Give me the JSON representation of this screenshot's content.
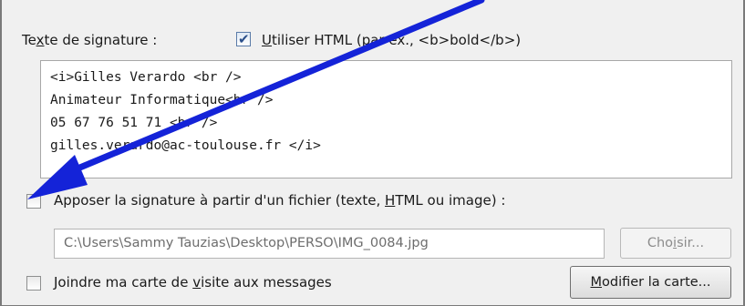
{
  "signature_label_prefix": "Te",
  "signature_label_accel": "x",
  "signature_label_suffix": "te de signature :",
  "use_html": {
    "checked": true,
    "label_accel": "U",
    "label_rest": "tiliser HTML (par ex., <b>bold</b>)"
  },
  "signature_text": "<i>Gilles Verardo <br />\nAnimateur Informatique<br />\n05 67 76 51 71 <br />\ngilles.verardo@ac-toulouse.fr </i>",
  "attach_file": {
    "checked": false,
    "label_prefix": "Apposer la signature à partir d'un fichier (texte, ",
    "label_accel": "H",
    "label_suffix": "TML ou image) :"
  },
  "file_path": "C:\\Users\\Sammy Tauzias\\Desktop\\PERSO\\IMG_0084.jpg",
  "choose_button": {
    "prefix": "Cho",
    "accel": "i",
    "suffix": "sir..."
  },
  "vcard": {
    "checked": false,
    "label_prefix": "Joindre ma carte de ",
    "label_accel": "v",
    "label_suffix": "isite aux messages"
  },
  "modify_button": {
    "accel": "M",
    "rest": "odifier la carte..."
  },
  "annotation_arrow_color": "#1423d8"
}
